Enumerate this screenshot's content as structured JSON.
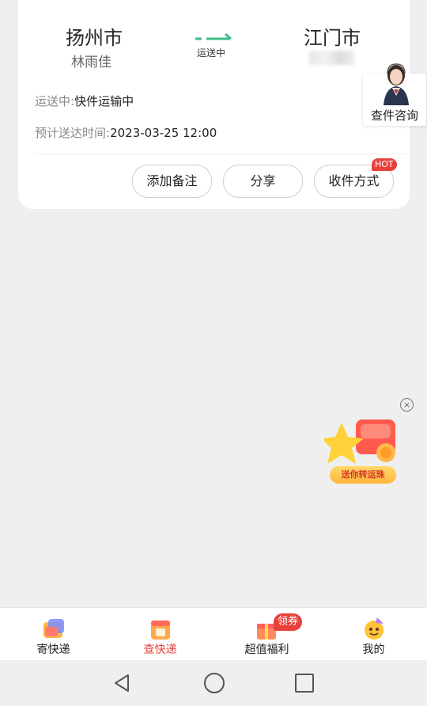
{
  "route": {
    "from_city": "扬州市",
    "from_name": "林雨佳",
    "to_city": "江门市",
    "status_arrow_label": "运送中"
  },
  "consult": {
    "label": "查件咨询",
    "icon": "customer-service-avatar"
  },
  "details": {
    "status_label": "运送中:",
    "status_value": "快件运输中",
    "eta_label": "预计送达时间:",
    "eta_value": "2023-03-25 12:00"
  },
  "actions": {
    "add_note": "添加备注",
    "share": "分享",
    "delivery_method": "收件方式",
    "hot_badge": "HOT"
  },
  "promo": {
    "label": "送你转运珠",
    "close_symbol": "×"
  },
  "tabbar": {
    "items": [
      {
        "label": "寄快递",
        "icon": "send-package-icon"
      },
      {
        "label": "查快递",
        "icon": "track-package-icon"
      },
      {
        "label": "超值福利",
        "icon": "gift-icon"
      },
      {
        "label": "我的",
        "icon": "profile-icon"
      }
    ],
    "coupon_badge": "领券",
    "active_index": 1
  },
  "colors": {
    "accent_red": "#e8413b",
    "arrow_green": "#3cbf8a",
    "background": "#efefef"
  }
}
